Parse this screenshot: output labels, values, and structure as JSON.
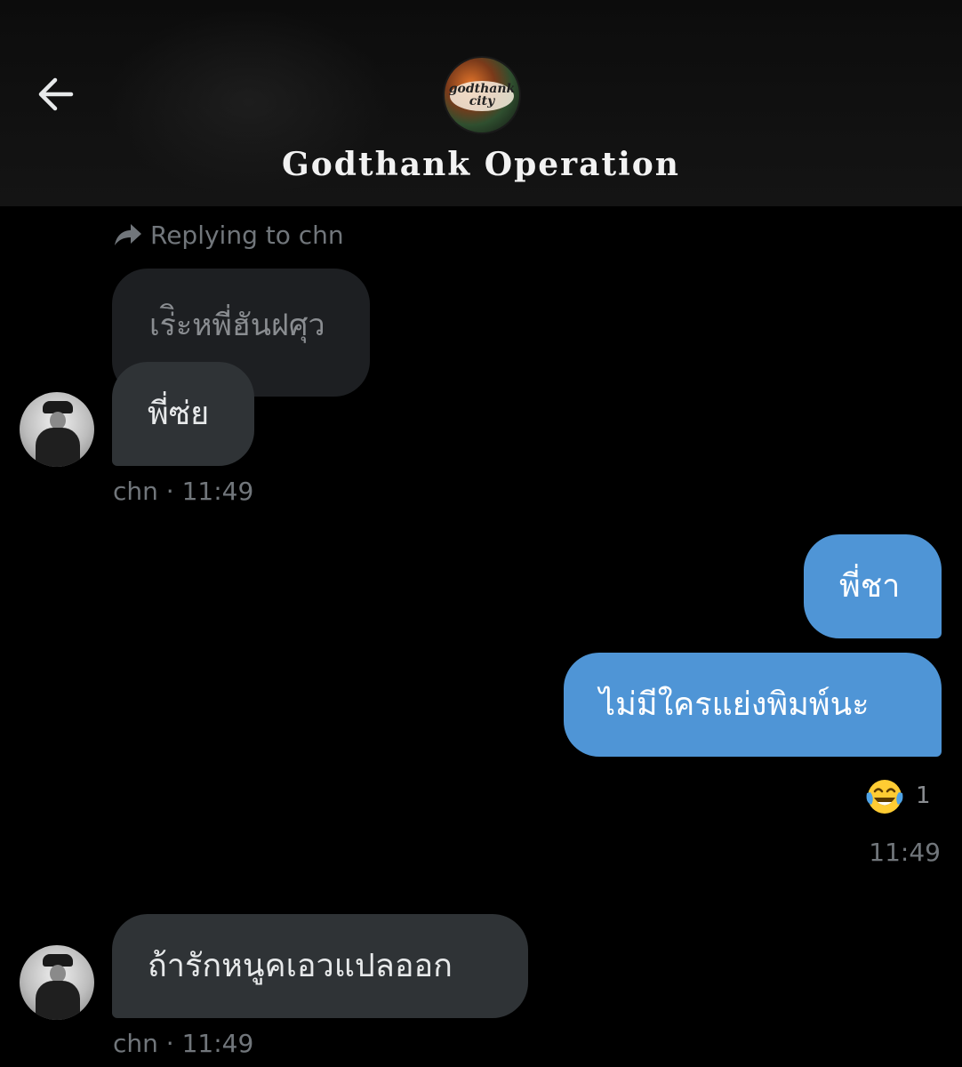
{
  "header": {
    "title": "Godthank Operation",
    "avatar_logo_line1": "godthank",
    "avatar_logo_line2": "city"
  },
  "reply": {
    "label": "Replying to chn",
    "quoted_text": "เร่ิะหพี่ฮันฝศุว"
  },
  "messages": [
    {
      "id": "m1",
      "direction": "incoming",
      "text": "พี่ซ่ย"
    },
    {
      "id": "m2",
      "direction": "outgoing",
      "text": "พี่ชา"
    },
    {
      "id": "m3",
      "direction": "outgoing",
      "text": "ไม่มีใครแย่งพิมพ์นะ"
    },
    {
      "id": "m4",
      "direction": "incoming",
      "text": "ถ้ารักหนูคเอวแปลออก"
    }
  ],
  "meta": {
    "m1": "chn · 11:49",
    "m3_time": "11:49",
    "m4": "chn · 11:49"
  },
  "reaction": {
    "emoji": "face-with-tears-of-joy",
    "count": "1"
  },
  "colors": {
    "background": "#000000",
    "incoming_bubble": "#2f3336",
    "outgoing_bubble": "#4f95d6",
    "secondary_text": "#71767b"
  }
}
